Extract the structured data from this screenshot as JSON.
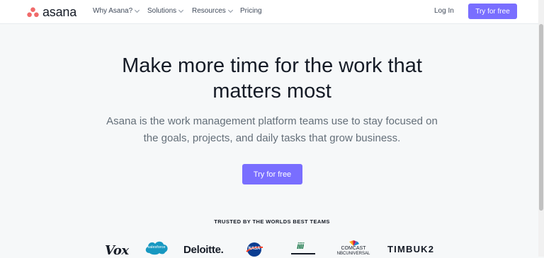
{
  "header": {
    "brand": "asana",
    "nav": [
      {
        "label": "Why Asana?",
        "dropdown": true
      },
      {
        "label": "Solutions",
        "dropdown": true
      },
      {
        "label": "Resources",
        "dropdown": true
      },
      {
        "label": "Pricing",
        "dropdown": false
      }
    ],
    "login": "Log In",
    "cta": "Try for free"
  },
  "hero": {
    "headline_line1": "Make more time for the work that",
    "headline_line2": "matters most",
    "sub_line1": "Asana is the work management platform teams use to stay focused on",
    "sub_line2": "the goals, projects, and daily tasks that grow business.",
    "cta": "Try for free"
  },
  "trusted": {
    "heading": "TRUSTED BY THE WORLDS BEST TEAMS",
    "logos": [
      {
        "name": "Vox",
        "text": "Vox"
      },
      {
        "name": "Salesforce",
        "text": "salesforce"
      },
      {
        "name": "Deloitte",
        "text": "Deloitte."
      },
      {
        "name": "NASA",
        "text": "NASA"
      },
      {
        "name": "Joy",
        "text": "iiii"
      },
      {
        "name": "Comcast NBCUniversal",
        "text": "COMCAST",
        "text2": "NBCUNIVERSAL"
      },
      {
        "name": "Timbuk2",
        "text": "TIMBUK2"
      }
    ]
  },
  "colors": {
    "brand_coral": "#f06a6a",
    "cta_purple": "#796eff",
    "text_dark": "#151b26",
    "text_muted": "#646f79",
    "page_bg": "#f6f8f9"
  }
}
